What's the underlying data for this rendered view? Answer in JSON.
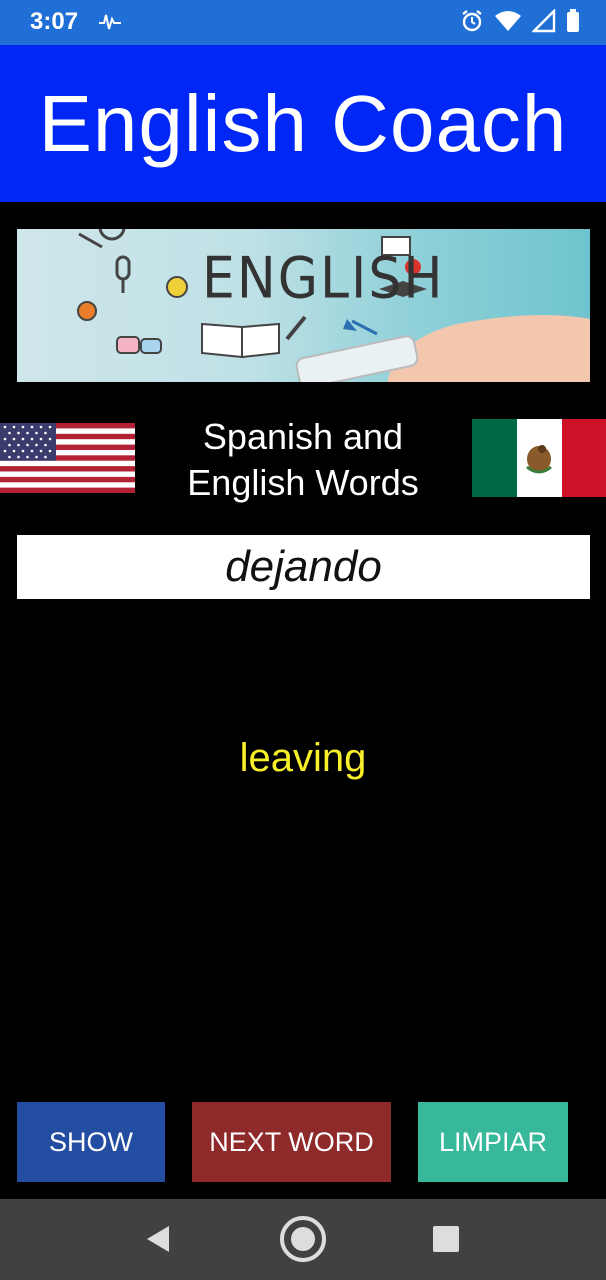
{
  "status_bar": {
    "time": "3:07",
    "icons": [
      "pulse-icon",
      "alarm-icon",
      "wifi-icon",
      "signal-icon",
      "battery-icon"
    ]
  },
  "app_bar": {
    "title": "English Coach",
    "color": "#0027f5"
  },
  "banner": {
    "text": "ENGLISH"
  },
  "subtitle": {
    "line1": "Spanish and",
    "line2": "English Words"
  },
  "word": {
    "spanish": "dejando"
  },
  "translation": {
    "english": "leaving",
    "color": "#f7ef29"
  },
  "buttons": {
    "show": "SHOW",
    "next_word": "NEXT WORD",
    "clear": "LIMPIAR"
  },
  "nav_bar": {
    "icons": [
      "back-icon",
      "home-icon",
      "recents-icon"
    ]
  }
}
